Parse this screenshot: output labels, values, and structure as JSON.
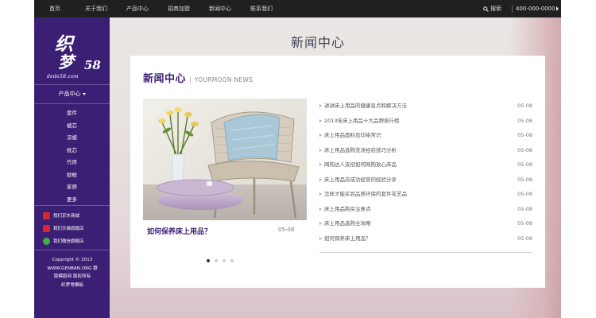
{
  "topbar": {
    "nav": [
      "首页",
      "关于我们",
      "产品中心",
      "招商加盟",
      "新闻中心",
      "联系我们"
    ],
    "search_label": "搜索",
    "search_icon": "search-icon",
    "phone": "400-000-0000"
  },
  "sidebar": {
    "logo": {
      "line1": "织",
      "line2": "梦",
      "num": "58",
      "sub": "dede58.com"
    },
    "category_title": "产品中心",
    "categories": [
      "套件",
      "被芯",
      "凉被",
      "枕芯",
      "竹席",
      "蚊帐",
      "家居",
      "更多"
    ],
    "shops": [
      {
        "label": "我们京东商城",
        "icon": "jd-icon",
        "color": "#d9242a"
      },
      {
        "label": "我们天猫旗舰店",
        "icon": "tmall-icon",
        "color": "#e6202a"
      },
      {
        "label": "我们微信旗舰店",
        "icon": "wechat-icon",
        "color": "#3bb53a"
      }
    ],
    "copyright": [
      "Copyright © 2013",
      "WWW.GENBAN.ORG 跟",
      "版模版网 版权所有",
      "织梦常模板"
    ]
  },
  "banner": {
    "title": "新闻中心"
  },
  "section": {
    "title_cn": "新闻中心",
    "divider": "|",
    "title_en": "YOURMOON NEWS"
  },
  "feature": {
    "caption": "如何保养床上用品？",
    "date": "05-08",
    "slides": 4,
    "active_slide": 0
  },
  "news": [
    {
      "title": "讲讲床上用品的健康盲点和解决方法",
      "date": "05-08"
    },
    {
      "title": "2013年床上用品十大品牌排行榜",
      "date": "05-08"
    },
    {
      "title": "床上用品面料及印染常识",
      "date": "05-08"
    },
    {
      "title": "床上用品选购洗涤经验技巧分析",
      "date": "05-08"
    },
    {
      "title": "网购达人支招如何网购放心床品",
      "date": "05-08"
    },
    {
      "title": "床上用品店成功经营的经验分享",
      "date": "05-08"
    },
    {
      "title": "怎样才能买到品质环保的套件花艺品",
      "date": "05-08"
    },
    {
      "title": "床上用品购买注意点",
      "date": "05-08"
    },
    {
      "title": "床上用品选购全攻略",
      "date": "05-08"
    },
    {
      "title": "如何保养床上用品？",
      "date": "05-08"
    }
  ],
  "colors": {
    "brand": "#3b1f74",
    "topbar": "#202020"
  }
}
